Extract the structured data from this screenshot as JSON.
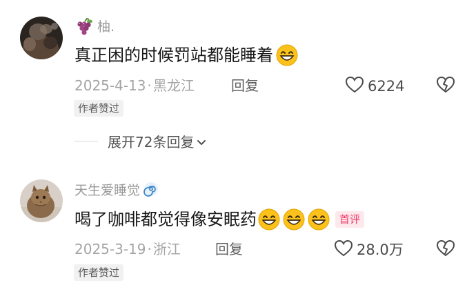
{
  "comments": [
    {
      "username": "柚.",
      "username_prefix_icon": "grapes-icon",
      "text": "真正困的时候罚站都能睡着",
      "emoji": "grinning-face-emoji",
      "date": "2025-4-13",
      "location": "黑龙江",
      "separator": "·",
      "reply_label": "回复",
      "likes": "6224",
      "author_liked": "作者赞过",
      "expand_label": "展开72条回复"
    },
    {
      "username": "天生爱睡觉",
      "username_suffix_icon": "spiral-icon",
      "text": "喝了咖啡都觉得像安眠药",
      "emoji": "grinning-face-emoji",
      "first_badge": "首评",
      "date": "2025-3-19",
      "location": "浙江",
      "separator": "·",
      "reply_label": "回复",
      "likes": "28.0万",
      "author_liked": "作者赞过"
    }
  ],
  "colors": {
    "username": "#9a9a9a",
    "text": "#161616",
    "meta": "#a4a4a4",
    "first_badge": "#f0386a",
    "emoji_face": "#fcc21b"
  }
}
